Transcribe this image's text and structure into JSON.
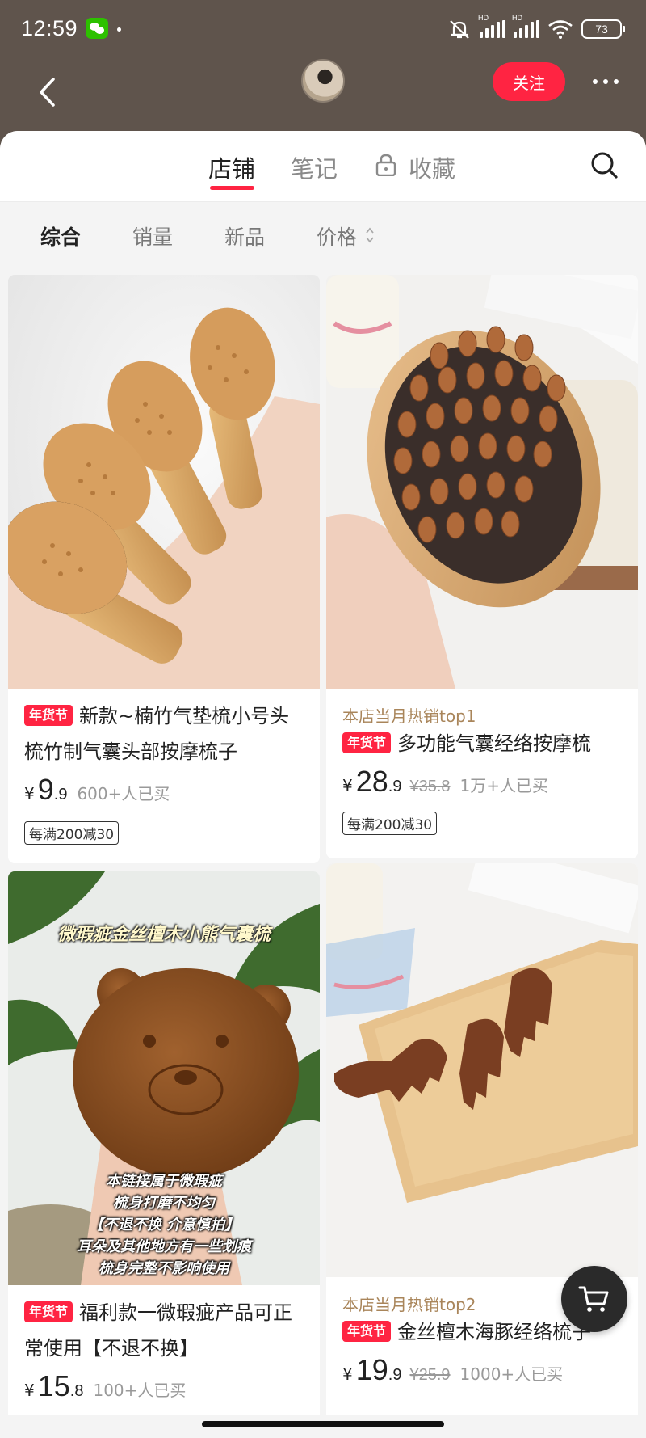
{
  "status_bar": {
    "time": "12:59",
    "battery": "73",
    "signal_label": "HD",
    "icons": [
      "wechat-icon",
      "mute-icon",
      "signal-icon",
      "signal-icon",
      "wifi-icon",
      "battery-icon"
    ]
  },
  "header": {
    "follow_label": "关注",
    "back_icon": "chevron-left-icon",
    "more_icon": "more-dots-icon"
  },
  "tabs": [
    {
      "label": "店铺",
      "active": true
    },
    {
      "label": "笔记",
      "active": false
    },
    {
      "label": "收藏",
      "active": false,
      "icon": "lock-icon"
    }
  ],
  "filters": [
    {
      "label": "综合",
      "active": true
    },
    {
      "label": "销量",
      "active": false
    },
    {
      "label": "新品",
      "active": false
    },
    {
      "label": "价格",
      "active": false,
      "icon": "sort-icon"
    }
  ],
  "products": [
    {
      "hot_tag": "",
      "badge": "年货节",
      "title": "新款~楠竹气垫梳小号头梳竹制气囊头部按摩梳子",
      "currency": "¥",
      "price_int": "9",
      "price_dec": ".9",
      "original_price": "",
      "sold": "600+人已买",
      "coupon": "每满200减30"
    },
    {
      "hot_tag": "本店当月热销top1",
      "badge": "年货节",
      "title": "多功能气囊经络按摩梳",
      "currency": "¥",
      "price_int": "28",
      "price_dec": ".9",
      "original_price": "¥35.8",
      "sold": "1万+人已买",
      "coupon": "每满200减30"
    },
    {
      "hot_tag": "",
      "badge": "年货节",
      "title": "福利款一微瑕疵产品可正常使用【不退不换】",
      "currency": "¥",
      "price_int": "15",
      "price_dec": ".8",
      "original_price": "",
      "sold": "100+人已买",
      "coupon": "",
      "image_caption_top": "微瑕疵金丝檀木小熊气囊梳",
      "image_caption_lines": [
        "本链接属于微瑕疵",
        "梳身打磨不均匀",
        "【不退不换 介意慎拍】",
        "耳朵及其他地方有一些划痕",
        "梳身完整不影响使用"
      ]
    },
    {
      "hot_tag": "本店当月热销top2",
      "badge": "年货节",
      "title": "金丝檀木海豚经络梳子",
      "currency": "¥",
      "price_int": "19",
      "price_dec": ".9",
      "original_price": "¥25.9",
      "sold": "1000+人已买",
      "coupon": ""
    }
  ],
  "cart_icon": "cart-icon",
  "colors": {
    "accent": "#ff2442",
    "header_bg": "#5f544c",
    "hot_tag": "#a9855a"
  }
}
